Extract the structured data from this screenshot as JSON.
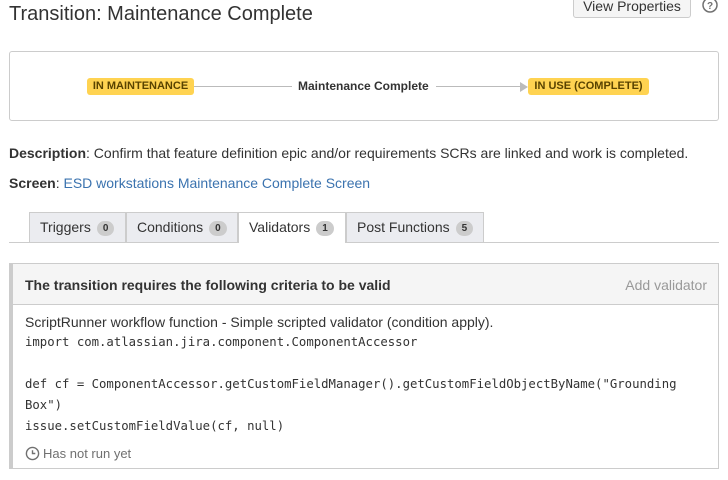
{
  "page": {
    "title": "Transition: Maintenance Complete",
    "view_properties_label": "View Properties",
    "help_icon": "question-circle-icon"
  },
  "diagram": {
    "from_status": "IN MAINTENANCE",
    "transition_name": "Maintenance Complete",
    "to_status": "IN USE (COMPLETE)",
    "status_color": "#ffd351"
  },
  "info": {
    "description_label": "Description",
    "description_text": ": Confirm that feature definition epic and/or requirements SCRs are linked and work is completed.",
    "screen_label": "Screen",
    "screen_sep": ": ",
    "screen_link": "ESD workstations Maintenance Complete Screen"
  },
  "tabs": [
    {
      "label": "Triggers",
      "count": "0",
      "active": false
    },
    {
      "label": "Conditions",
      "count": "0",
      "active": false
    },
    {
      "label": "Validators",
      "count": "1",
      "active": true
    },
    {
      "label": "Post Functions",
      "count": "5",
      "active": false
    }
  ],
  "validators": {
    "header": "The transition requires the following criteria to be valid",
    "add_label": "Add validator",
    "item": {
      "description": "ScriptRunner workflow function - Simple scripted validator (condition apply).",
      "code": "import com.atlassian.jira.component.ComponentAccessor\n\ndef cf = ComponentAccessor.getCustomFieldManager().getCustomFieldObjectByName(\"Grounding Box\")\nissue.setCustomFieldValue(cf, null)",
      "status_icon": "clock-icon",
      "status": "Has not run yet"
    }
  }
}
